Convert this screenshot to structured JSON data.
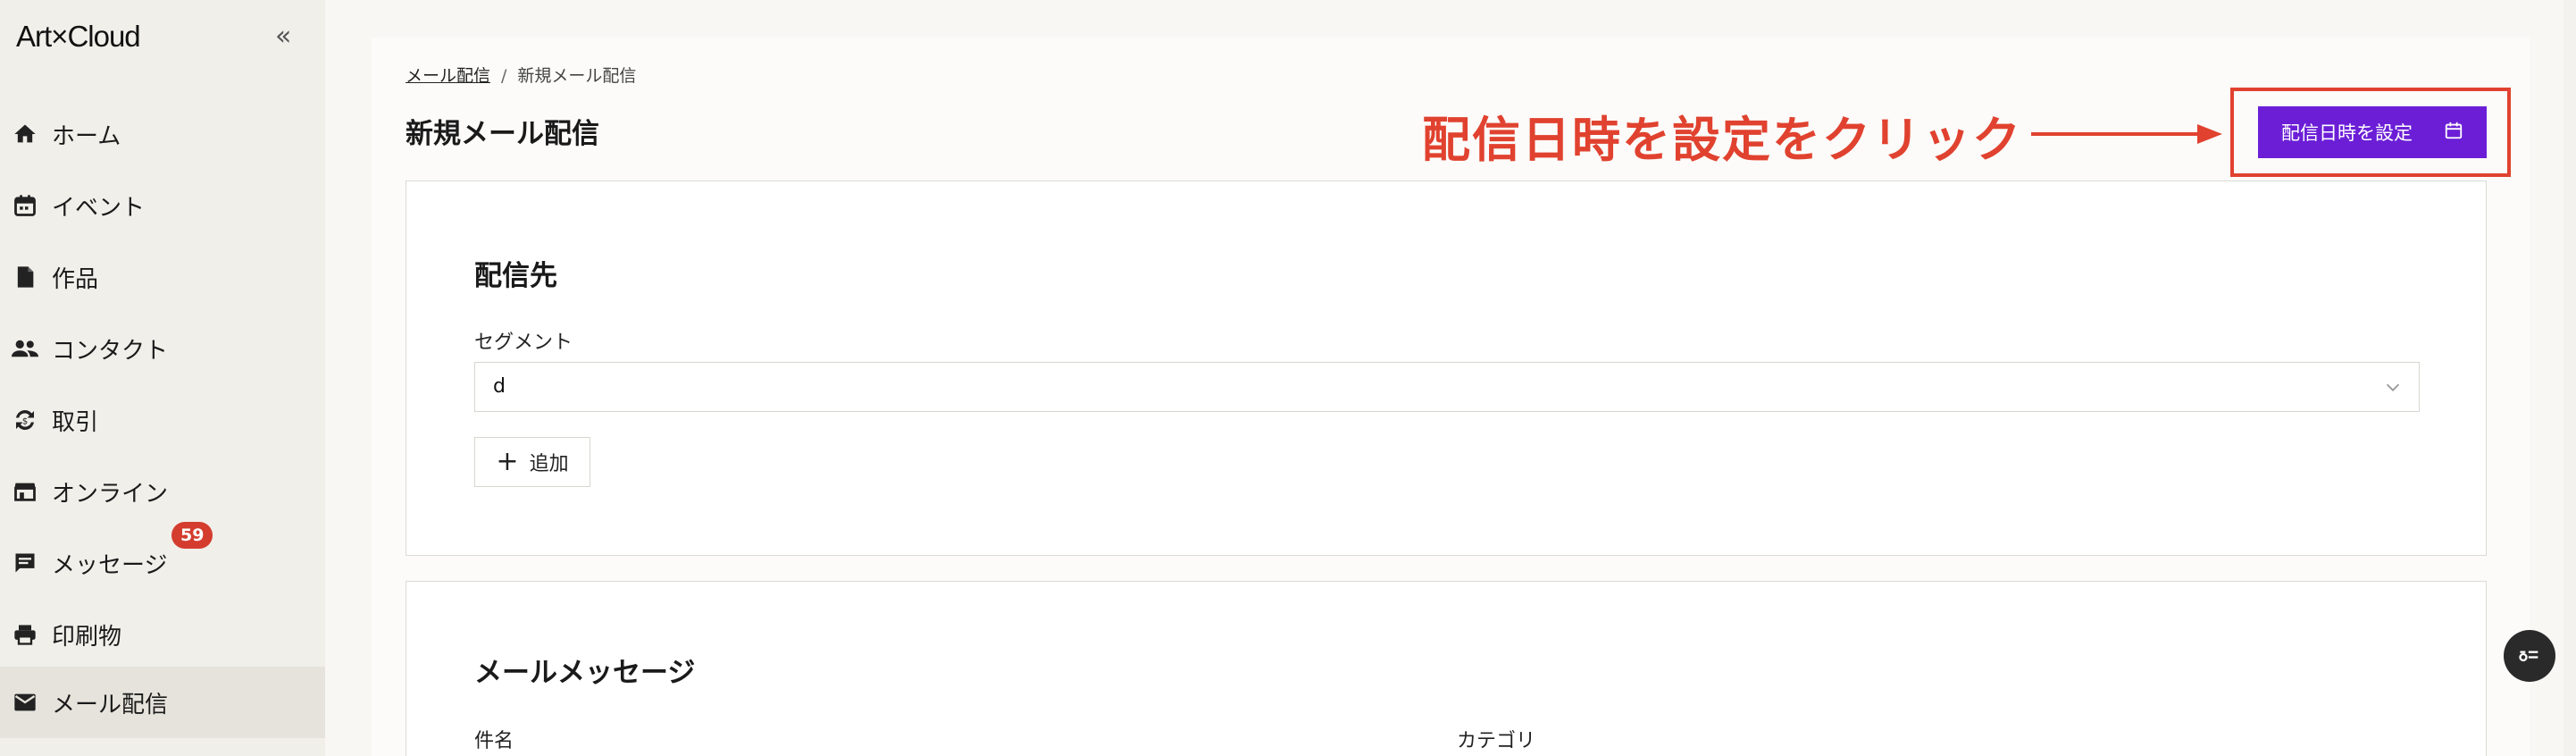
{
  "app": {
    "logo": "Art×Cloud",
    "collapse_glyph": "«"
  },
  "sidebar": {
    "items": [
      {
        "label": "ホーム",
        "icon": "home-icon"
      },
      {
        "label": "イベント",
        "icon": "calendar-icon"
      },
      {
        "label": "作品",
        "icon": "document-icon"
      },
      {
        "label": "コンタクト",
        "icon": "people-icon"
      },
      {
        "label": "取引",
        "icon": "exchange-icon"
      },
      {
        "label": "オンライン",
        "icon": "storefront-icon"
      },
      {
        "label": "メッセージ",
        "icon": "message-icon",
        "badge": "59"
      },
      {
        "label": "印刷物",
        "icon": "printer-icon"
      },
      {
        "label": "メール配信",
        "icon": "mail-icon",
        "active": true
      }
    ]
  },
  "breadcrumb": {
    "parent": "メール配信",
    "current": "新規メール配信"
  },
  "page": {
    "title": "新規メール配信"
  },
  "annotation": {
    "text": "配信日時を設定をクリック",
    "color": "#e0422f"
  },
  "toolbar": {
    "schedule_label": "配信日時を設定",
    "accent": "#6b1ed6"
  },
  "recipient": {
    "title": "配信先",
    "segment_label": "セグメント",
    "segment_value": "d",
    "add_label": "追加"
  },
  "message": {
    "title": "メールメッセージ",
    "subject_label": "件名",
    "category_label": "カテゴリ"
  }
}
